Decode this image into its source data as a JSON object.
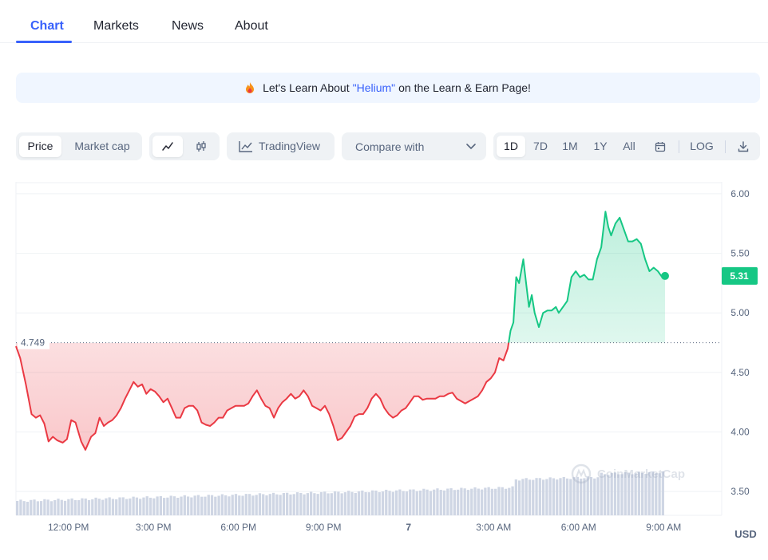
{
  "tabs": [
    {
      "label": "Chart",
      "active": true
    },
    {
      "label": "Markets",
      "active": false
    },
    {
      "label": "News",
      "active": false
    },
    {
      "label": "About",
      "active": false
    }
  ],
  "banner": {
    "prefix": "Let's Learn About",
    "highlight": "\"Helium\"",
    "suffix": "on the Learn & Earn Page!",
    "icon": "fire-icon"
  },
  "toolbar": {
    "metric": {
      "price": "Price",
      "market_cap": "Market cap",
      "selected": "Price"
    },
    "chart_type": {
      "line_icon": "line-chart-icon",
      "candle_icon": "candlestick-icon",
      "selected": "line"
    },
    "tradingview": {
      "label": "TradingView",
      "icon": "tradingview-icon"
    },
    "compare": {
      "label": "Compare with",
      "icon": "chevron-down-icon"
    },
    "ranges": [
      "1D",
      "7D",
      "1M",
      "1Y",
      "All"
    ],
    "range_selected": "1D",
    "calendar_icon": "calendar-icon",
    "log_label": "LOG",
    "download_icon": "download-icon"
  },
  "colors": {
    "accent": "#3861fb",
    "up": "#16c784",
    "down": "#ea3943",
    "volume": "#cfd6e4"
  },
  "chart_data": {
    "type": "line",
    "currency_label": "USD",
    "reference_label": "4.749",
    "reference_value": 4.749,
    "current_value_label": "5.31",
    "current_value": 5.31,
    "ylim": [
      3.3,
      6.1
    ],
    "y_ticks": [
      6.0,
      5.5,
      5.0,
      4.5,
      4.0,
      3.5
    ],
    "y_tick_labels": [
      "6.00",
      "5.50",
      "5.00",
      "4.50",
      "4.00",
      "3.50"
    ],
    "x_range": [
      10.15,
      35.05
    ],
    "x_ticks": [
      {
        "x": 12,
        "label": "12:00 PM"
      },
      {
        "x": 15,
        "label": "3:00 PM"
      },
      {
        "x": 18,
        "label": "6:00 PM"
      },
      {
        "x": 21,
        "label": "9:00 PM"
      },
      {
        "x": 24,
        "label": "7"
      },
      {
        "x": 27,
        "label": "3:00 AM"
      },
      {
        "x": 30,
        "label": "6:00 AM"
      },
      {
        "x": 33,
        "label": "9:00 AM"
      }
    ],
    "x_unit_note": "hours since midnight of the first day",
    "series": [
      {
        "points": [
          [
            10.15,
            4.72
          ],
          [
            10.3,
            4.62
          ],
          [
            10.5,
            4.4
          ],
          [
            10.7,
            4.15
          ],
          [
            10.85,
            4.12
          ],
          [
            11.0,
            4.14
          ],
          [
            11.15,
            4.07
          ],
          [
            11.3,
            3.92
          ],
          [
            11.45,
            3.96
          ],
          [
            11.6,
            3.93
          ],
          [
            11.8,
            3.91
          ],
          [
            11.95,
            3.94
          ],
          [
            12.1,
            4.1
          ],
          [
            12.25,
            4.08
          ],
          [
            12.45,
            3.92
          ],
          [
            12.6,
            3.85
          ],
          [
            12.8,
            3.96
          ],
          [
            12.95,
            3.99
          ],
          [
            13.1,
            4.12
          ],
          [
            13.25,
            4.05
          ],
          [
            13.4,
            4.08
          ],
          [
            13.55,
            4.1
          ],
          [
            13.7,
            4.14
          ],
          [
            13.85,
            4.2
          ],
          [
            14.0,
            4.28
          ],
          [
            14.15,
            4.35
          ],
          [
            14.3,
            4.42
          ],
          [
            14.45,
            4.38
          ],
          [
            14.6,
            4.4
          ],
          [
            14.75,
            4.32
          ],
          [
            14.9,
            4.36
          ],
          [
            15.05,
            4.34
          ],
          [
            15.2,
            4.3
          ],
          [
            15.35,
            4.25
          ],
          [
            15.5,
            4.28
          ],
          [
            15.65,
            4.2
          ],
          [
            15.8,
            4.12
          ],
          [
            15.95,
            4.12
          ],
          [
            16.1,
            4.2
          ],
          [
            16.25,
            4.22
          ],
          [
            16.4,
            4.22
          ],
          [
            16.55,
            4.18
          ],
          [
            16.7,
            4.08
          ],
          [
            16.85,
            4.06
          ],
          [
            17.0,
            4.05
          ],
          [
            17.15,
            4.08
          ],
          [
            17.3,
            4.12
          ],
          [
            17.45,
            4.12
          ],
          [
            17.6,
            4.18
          ],
          [
            17.75,
            4.2
          ],
          [
            17.9,
            4.22
          ],
          [
            18.05,
            4.22
          ],
          [
            18.2,
            4.22
          ],
          [
            18.35,
            4.24
          ],
          [
            18.5,
            4.3
          ],
          [
            18.65,
            4.35
          ],
          [
            18.8,
            4.28
          ],
          [
            18.95,
            4.22
          ],
          [
            19.1,
            4.2
          ],
          [
            19.25,
            4.12
          ],
          [
            19.4,
            4.2
          ],
          [
            19.55,
            4.25
          ],
          [
            19.7,
            4.28
          ],
          [
            19.85,
            4.32
          ],
          [
            20.0,
            4.28
          ],
          [
            20.15,
            4.3
          ],
          [
            20.3,
            4.35
          ],
          [
            20.45,
            4.3
          ],
          [
            20.6,
            4.22
          ],
          [
            20.75,
            4.2
          ],
          [
            20.9,
            4.18
          ],
          [
            21.05,
            4.22
          ],
          [
            21.2,
            4.15
          ],
          [
            21.35,
            4.05
          ],
          [
            21.5,
            3.93
          ],
          [
            21.65,
            3.95
          ],
          [
            21.8,
            4.0
          ],
          [
            21.95,
            4.05
          ],
          [
            22.1,
            4.13
          ],
          [
            22.25,
            4.15
          ],
          [
            22.4,
            4.15
          ],
          [
            22.55,
            4.2
          ],
          [
            22.7,
            4.28
          ],
          [
            22.85,
            4.32
          ],
          [
            23.0,
            4.28
          ],
          [
            23.15,
            4.2
          ],
          [
            23.3,
            4.15
          ],
          [
            23.45,
            4.12
          ],
          [
            23.6,
            4.14
          ],
          [
            23.75,
            4.18
          ],
          [
            23.9,
            4.2
          ],
          [
            24.05,
            4.25
          ],
          [
            24.2,
            4.3
          ],
          [
            24.35,
            4.3
          ],
          [
            24.5,
            4.27
          ],
          [
            24.65,
            4.28
          ],
          [
            24.8,
            4.28
          ],
          [
            24.95,
            4.28
          ],
          [
            25.1,
            4.3
          ],
          [
            25.25,
            4.3
          ],
          [
            25.4,
            4.32
          ],
          [
            25.55,
            4.33
          ],
          [
            25.7,
            4.28
          ],
          [
            25.85,
            4.26
          ],
          [
            26.0,
            4.24
          ],
          [
            26.15,
            4.26
          ],
          [
            26.3,
            4.28
          ],
          [
            26.45,
            4.3
          ],
          [
            26.6,
            4.35
          ],
          [
            26.75,
            4.42
          ],
          [
            26.9,
            4.45
          ],
          [
            27.05,
            4.5
          ],
          [
            27.2,
            4.62
          ],
          [
            27.35,
            4.6
          ],
          [
            27.5,
            4.7
          ],
          [
            27.6,
            4.85
          ],
          [
            27.7,
            4.92
          ],
          [
            27.8,
            5.3
          ],
          [
            27.9,
            5.25
          ],
          [
            28.05,
            5.45
          ],
          [
            28.15,
            5.25
          ],
          [
            28.25,
            5.05
          ],
          [
            28.35,
            5.15
          ],
          [
            28.45,
            5.0
          ],
          [
            28.6,
            4.88
          ],
          [
            28.75,
            5.0
          ],
          [
            28.9,
            5.02
          ],
          [
            29.05,
            5.02
          ],
          [
            29.2,
            5.05
          ],
          [
            29.3,
            5.0
          ],
          [
            29.45,
            5.05
          ],
          [
            29.6,
            5.1
          ],
          [
            29.75,
            5.3
          ],
          [
            29.9,
            5.35
          ],
          [
            30.05,
            5.3
          ],
          [
            30.2,
            5.32
          ],
          [
            30.35,
            5.28
          ],
          [
            30.5,
            5.28
          ],
          [
            30.65,
            5.45
          ],
          [
            30.8,
            5.55
          ],
          [
            30.95,
            5.85
          ],
          [
            31.05,
            5.72
          ],
          [
            31.15,
            5.65
          ],
          [
            31.3,
            5.75
          ],
          [
            31.45,
            5.8
          ],
          [
            31.6,
            5.7
          ],
          [
            31.75,
            5.6
          ],
          [
            31.9,
            5.6
          ],
          [
            32.05,
            5.62
          ],
          [
            32.2,
            5.58
          ],
          [
            32.35,
            5.45
          ],
          [
            32.5,
            5.35
          ],
          [
            32.65,
            5.38
          ],
          [
            32.8,
            5.35
          ],
          [
            32.95,
            5.3
          ],
          [
            33.05,
            5.31
          ]
        ]
      }
    ],
    "volume_bars": 190
  },
  "watermark": "CoinMarketCap"
}
